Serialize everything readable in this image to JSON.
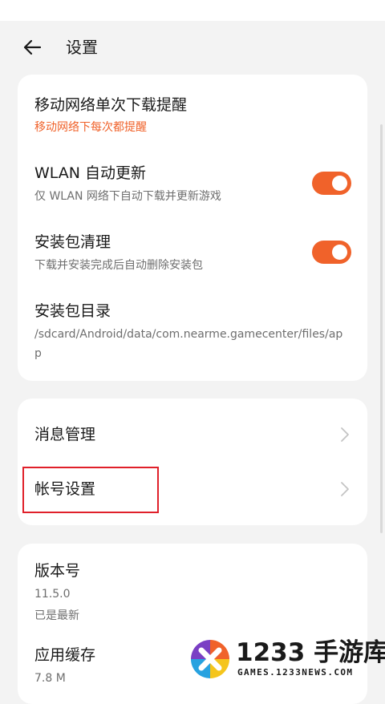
{
  "header": {
    "title": "设置",
    "back_icon": "arrow-left-icon"
  },
  "download_settings": {
    "mobile_reminder": {
      "title": "移动网络单次下载提醒",
      "value": "移动网络下每次都提醒"
    },
    "wlan_auto_update": {
      "title": "WLAN 自动更新",
      "desc": "仅 WLAN 网络下自动下载并更新游戏",
      "enabled": true
    },
    "package_cleanup": {
      "title": "安装包清理",
      "desc": "下载并安装完成后自动删除安装包",
      "enabled": true
    },
    "package_directory": {
      "title": "安装包目录",
      "path": "/sdcard/Android/data/com.nearme.gamecenter/files/app"
    }
  },
  "management": {
    "message_management": "消息管理",
    "account_settings": "帐号设置"
  },
  "about": {
    "version": {
      "title": "版本号",
      "number": "11.5.0",
      "status": "已是最新"
    },
    "cache": {
      "title": "应用缓存",
      "size": "7.8 M"
    }
  },
  "watermark": {
    "brand": "1233 手游库",
    "url": "GAMES.1233NEWS.COM"
  },
  "colors": {
    "accent": "#f0622a",
    "highlight": "#e0202a",
    "background": "#f3f3f3",
    "card": "#ffffff"
  }
}
